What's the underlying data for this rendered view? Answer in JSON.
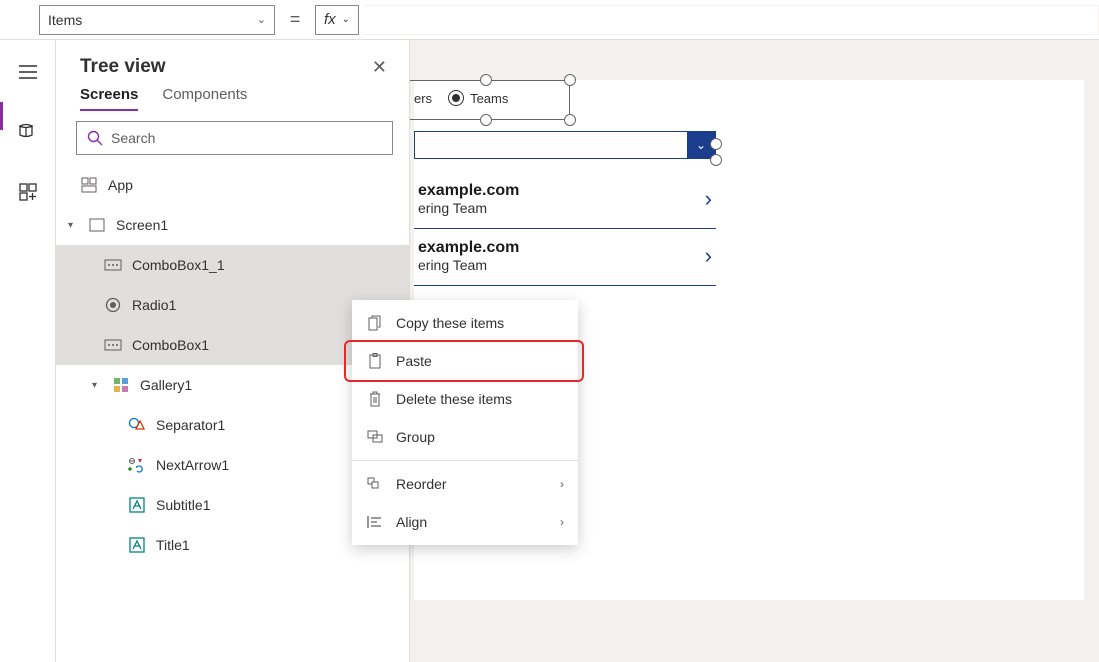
{
  "formula": {
    "property": "Items"
  },
  "tree": {
    "title": "Tree view",
    "tabs": {
      "screens": "Screens",
      "components": "Components",
      "active": "screens"
    },
    "search_placeholder": "Search",
    "nodes": {
      "app": "App",
      "screen1": "Screen1",
      "combobox1_1": "ComboBox1_1",
      "radio1": "Radio1",
      "combobox1": "ComboBox1",
      "gallery1": "Gallery1",
      "separator1": "Separator1",
      "nextarrow1": "NextArrow1",
      "subtitle1": "Subtitle1",
      "title1": "Title1"
    }
  },
  "canvas": {
    "radio": {
      "users_label_fragment": "ers",
      "teams_label": "Teams"
    },
    "list": [
      {
        "title_fragment": "example.com",
        "subtitle_fragment": "ering Team"
      },
      {
        "title_fragment": "example.com",
        "subtitle_fragment": "ering Team"
      }
    ]
  },
  "context_menu": {
    "copy": "Copy these items",
    "paste": "Paste",
    "delete": "Delete these items",
    "group": "Group",
    "reorder": "Reorder",
    "align": "Align"
  }
}
